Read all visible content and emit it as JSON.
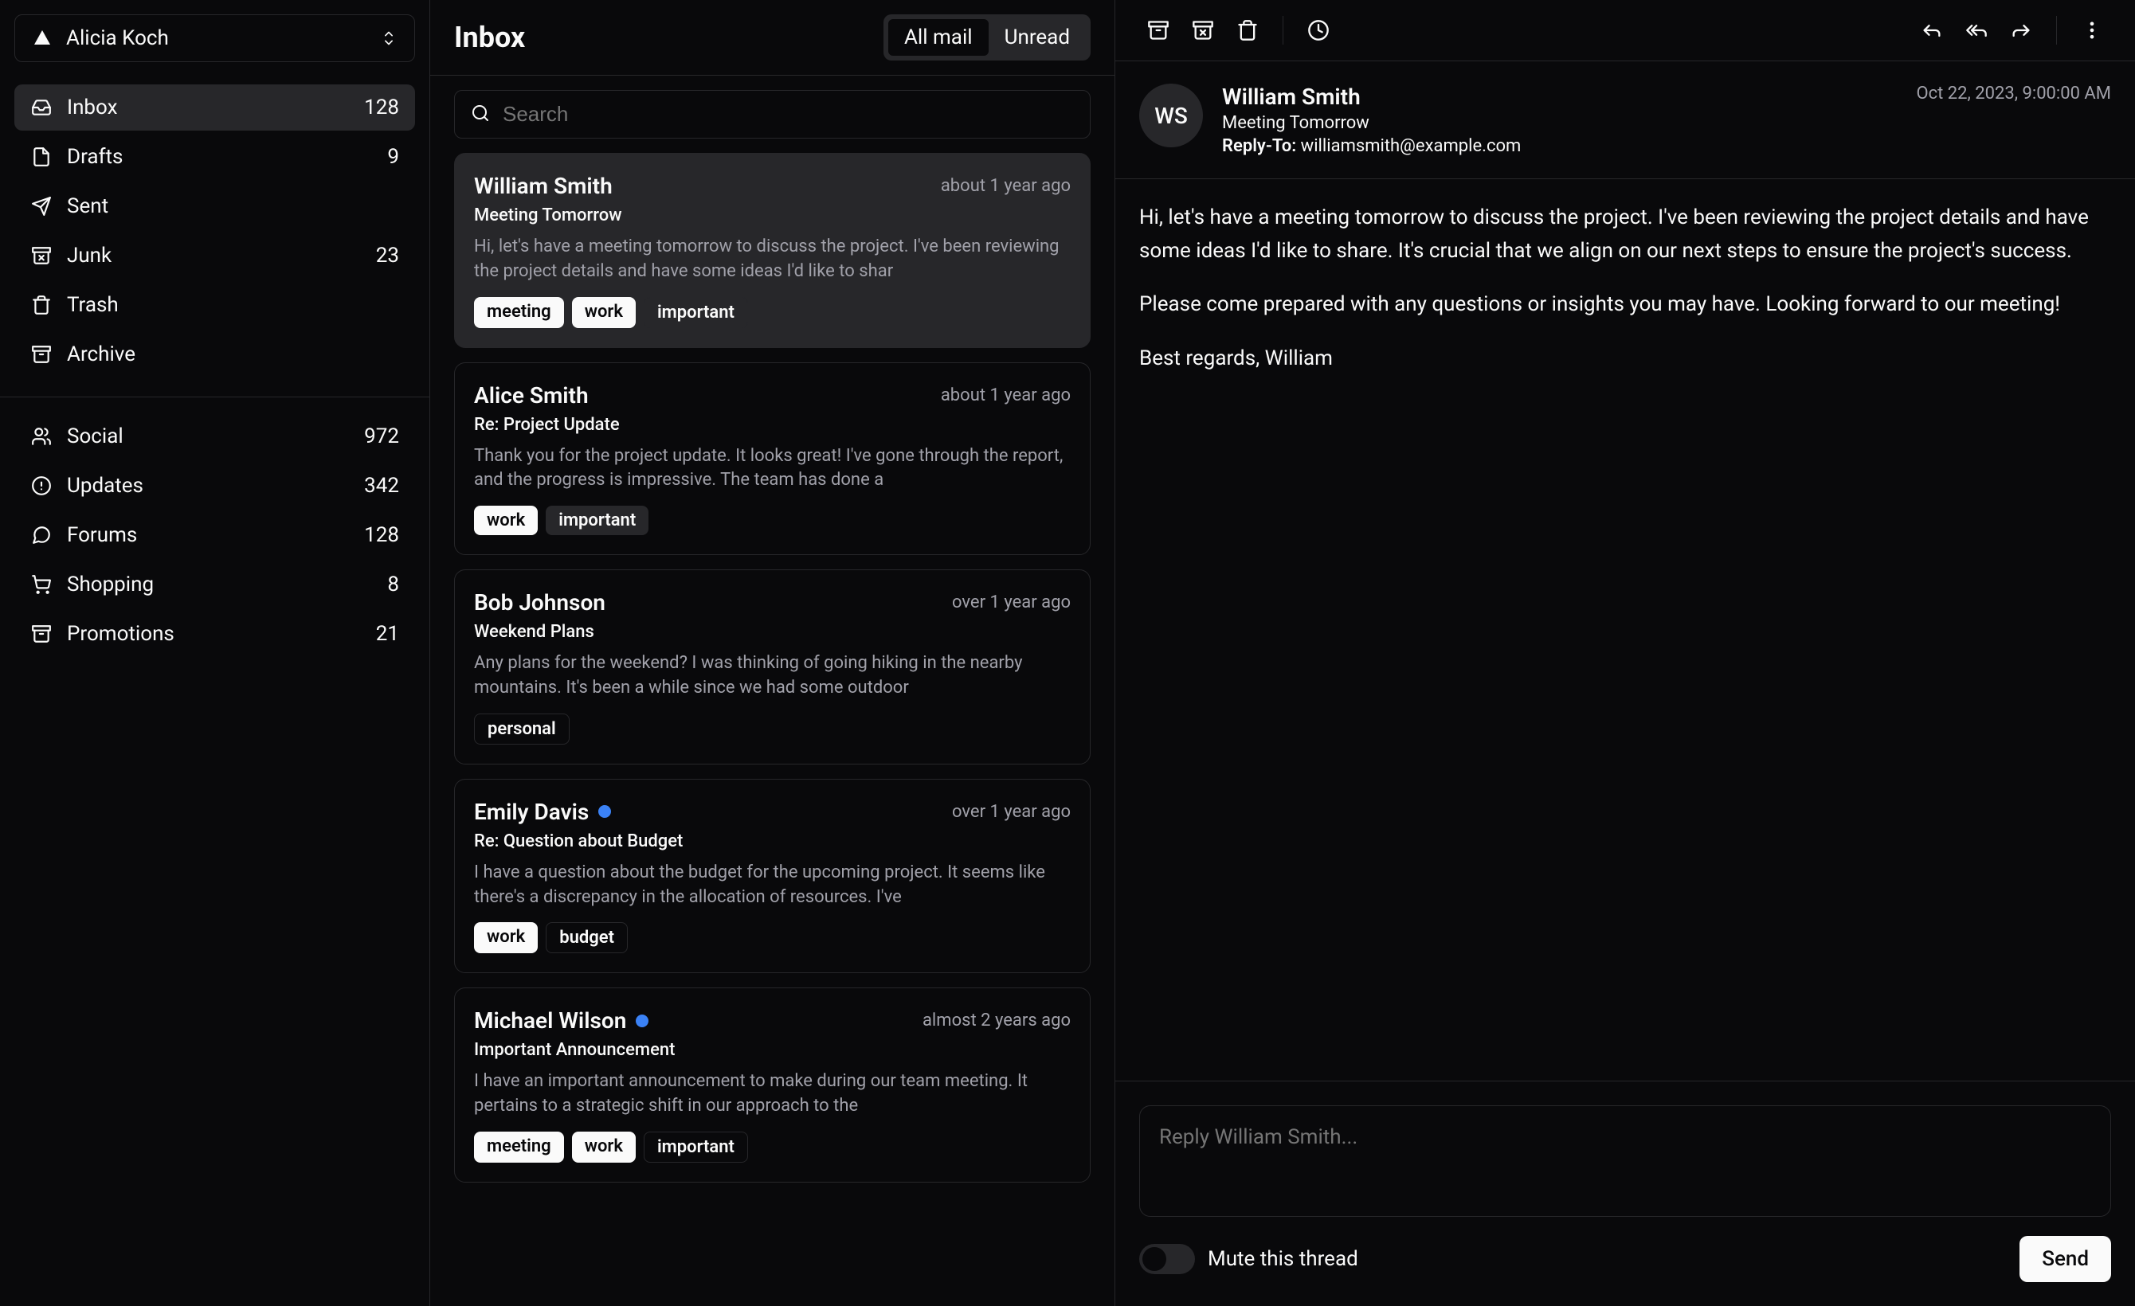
{
  "account": {
    "name": "Alicia Koch"
  },
  "sidebar": {
    "primary": [
      {
        "icon": "inbox",
        "label": "Inbox",
        "count": "128"
      },
      {
        "icon": "file",
        "label": "Drafts",
        "count": "9"
      },
      {
        "icon": "send",
        "label": "Sent",
        "count": ""
      },
      {
        "icon": "archive-x",
        "label": "Junk",
        "count": "23"
      },
      {
        "icon": "trash",
        "label": "Trash",
        "count": ""
      },
      {
        "icon": "archive",
        "label": "Archive",
        "count": ""
      }
    ],
    "secondary": [
      {
        "icon": "users",
        "label": "Social",
        "count": "972"
      },
      {
        "icon": "alert",
        "label": "Updates",
        "count": "342"
      },
      {
        "icon": "message",
        "label": "Forums",
        "count": "128"
      },
      {
        "icon": "cart",
        "label": "Shopping",
        "count": "8"
      },
      {
        "icon": "archive",
        "label": "Promotions",
        "count": "21"
      }
    ]
  },
  "inbox": {
    "title": "Inbox",
    "tabs": {
      "all": "All mail",
      "unread": "Unread"
    },
    "search_placeholder": "Search"
  },
  "emails": [
    {
      "sender": "William Smith",
      "subject": "Meeting Tomorrow",
      "time": "about 1 year ago",
      "preview": "Hi, let's have a meeting tomorrow to discuss the project. I've been reviewing the project details and have some ideas I'd like to shar",
      "tags": [
        "meeting",
        "work",
        "important"
      ],
      "unread": false
    },
    {
      "sender": "Alice Smith",
      "subject": "Re: Project Update",
      "time": "about 1 year ago",
      "preview": "Thank you for the project update. It looks great! I've gone through the report, and the progress is impressive. The team has done a",
      "tags": [
        "work",
        "important"
      ],
      "unread": false
    },
    {
      "sender": "Bob Johnson",
      "subject": "Weekend Plans",
      "time": "over 1 year ago",
      "preview": "Any plans for the weekend? I was thinking of going hiking in the nearby mountains. It's been a while since we had some outdoor",
      "tags": [
        "personal"
      ],
      "unread": false
    },
    {
      "sender": "Emily Davis",
      "subject": "Re: Question about Budget",
      "time": "over 1 year ago",
      "preview": "I have a question about the budget for the upcoming project. It seems like there's a discrepancy in the allocation of resources. I've",
      "tags": [
        "work",
        "budget"
      ],
      "unread": true
    },
    {
      "sender": "Michael Wilson",
      "subject": "Important Announcement",
      "time": "almost 2 years ago",
      "preview": "I have an important announcement to make during our team meeting. It pertains to a strategic shift in our approach to the",
      "tags": [
        "meeting",
        "work",
        "important"
      ],
      "unread": true
    }
  ],
  "detail": {
    "avatar": "WS",
    "sender": "William Smith",
    "subject": "Meeting Tomorrow",
    "reply_to_label": "Reply-To:",
    "reply_to": "williamsmith@example.com",
    "date": "Oct 22, 2023, 9:00:00 AM",
    "body_p1": "Hi, let's have a meeting tomorrow to discuss the project. I've been reviewing the project details and have some ideas I'd like to share. It's crucial that we align on our next steps to ensure the project's success.",
    "body_p2": "Please come prepared with any questions or insights you may have. Looking forward to our meeting!",
    "body_p3": "Best regards, William"
  },
  "reply": {
    "placeholder": "Reply William Smith...",
    "mute_label": "Mute this thread",
    "send_label": "Send"
  }
}
